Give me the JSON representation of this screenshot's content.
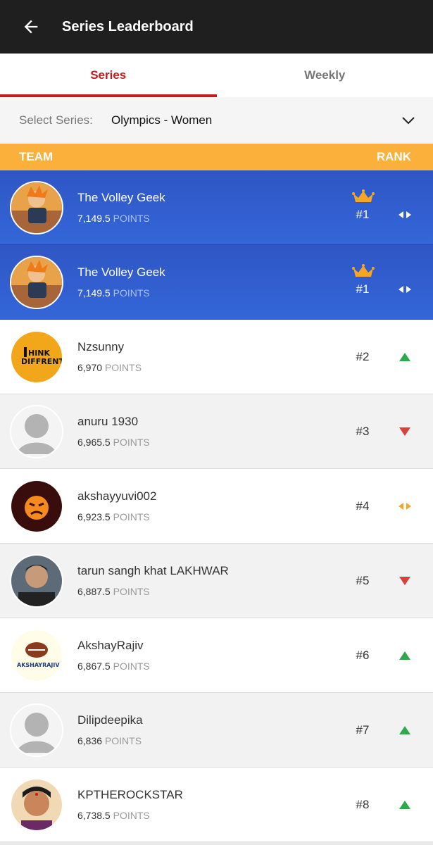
{
  "header": {
    "title": "Series Leaderboard"
  },
  "tabs": [
    {
      "label": "Series",
      "active": true
    },
    {
      "label": "Weekly",
      "active": false
    }
  ],
  "select": {
    "label": "Select Series:",
    "value": "Olympics - Women"
  },
  "table_header": {
    "team": "TEAM",
    "rank": "RANK"
  },
  "colors": {
    "accent_red": "#c8191c",
    "header_orange": "#fbb03b",
    "my_row_blue": "#3466d8",
    "up_green": "#2ea84a",
    "down_red": "#d9403a",
    "same_orange": "#f5a623"
  },
  "rows": [
    {
      "name": "The Volley Geek",
      "points": "7,149.5",
      "unit": "POINTS",
      "rank": "#1",
      "movement": "same",
      "crown": true,
      "highlight": true,
      "avatar": "anime-avatar"
    },
    {
      "name": "The Volley Geek",
      "points": "7,149.5",
      "unit": "POINTS",
      "rank": "#1",
      "movement": "same",
      "crown": true,
      "highlight": true,
      "avatar": "anime-avatar"
    },
    {
      "name": "Nzsunny",
      "points": "6,970",
      "unit": "POINTS",
      "rank": "#2",
      "movement": "up",
      "avatar": "think-different-logo",
      "avatar_text": "THINK DIFFRENT"
    },
    {
      "name": "anuru 1930",
      "points": "6,965.5",
      "unit": "POINTS",
      "rank": "#3",
      "movement": "down",
      "avatar": "default-user"
    },
    {
      "name": "akshayyuvi002",
      "points": "6,923.5",
      "unit": "POINTS",
      "rank": "#4",
      "movement": "same",
      "avatar": "angry-emoji"
    },
    {
      "name": "tarun sangh khat LAKHWAR",
      "points": "6,887.5",
      "unit": "POINTS",
      "rank": "#5",
      "movement": "down",
      "avatar": "photo-man"
    },
    {
      "name": "AkshayRajiv",
      "points": "6,867.5",
      "unit": "POINTS",
      "rank": "#6",
      "movement": "up",
      "avatar": "akshayrajiv-logo",
      "avatar_text": "AKSHAYRAJIV"
    },
    {
      "name": "Dilipdeepika",
      "points": "6,836",
      "unit": "POINTS",
      "rank": "#7",
      "movement": "up",
      "avatar": "default-user"
    },
    {
      "name": "KPTHEROCKSTAR",
      "points": "6,738.5",
      "unit": "POINTS",
      "rank": "#8",
      "movement": "up",
      "avatar": "photo-woman"
    }
  ]
}
